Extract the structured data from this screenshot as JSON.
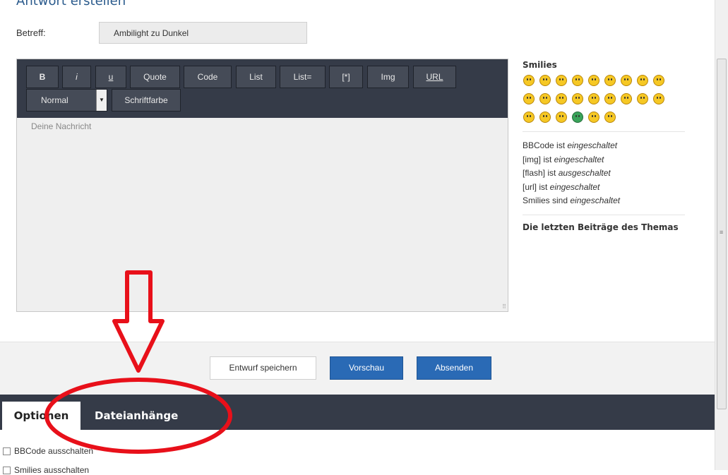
{
  "page": {
    "title": "Antwort erstellen"
  },
  "subject": {
    "label": "Betreff:",
    "value": "Ambilight zu Dunkel"
  },
  "toolbar": {
    "buttons": [
      "B",
      "i",
      "u",
      "Quote",
      "Code",
      "List",
      "List=",
      "[*]",
      "Img",
      "URL"
    ],
    "size_select": "Normal",
    "font_color": "Schriftfarbe"
  },
  "editor": {
    "placeholder": "Deine Nachricht"
  },
  "sidebar": {
    "smilies_heading": "Smilies",
    "status": [
      {
        "prefix": "BBCode ist ",
        "state": "eingeschaltet"
      },
      {
        "prefix": "[img] ist ",
        "state": "eingeschaltet"
      },
      {
        "prefix": "[flash] ist ",
        "state": "ausgeschaltet"
      },
      {
        "prefix": "[url] ist ",
        "state": "eingeschaltet"
      },
      {
        "prefix": "Smilies sind ",
        "state": "eingeschaltet"
      }
    ],
    "recent_heading": "Die letzten Beiträge des Themas"
  },
  "actions": {
    "draft": "Entwurf speichern",
    "preview": "Vorschau",
    "send": "Absenden"
  },
  "tabs": {
    "options": "Optionen",
    "attachments": "Dateianhänge"
  },
  "options": {
    "bbcode_off": "BBCode ausschalten",
    "smilies_off": "Smilies ausschalten"
  },
  "colors": {
    "toolbar_bg": "#353b48",
    "primary_button": "#2a6ab5",
    "annotation": "#e8101a"
  }
}
